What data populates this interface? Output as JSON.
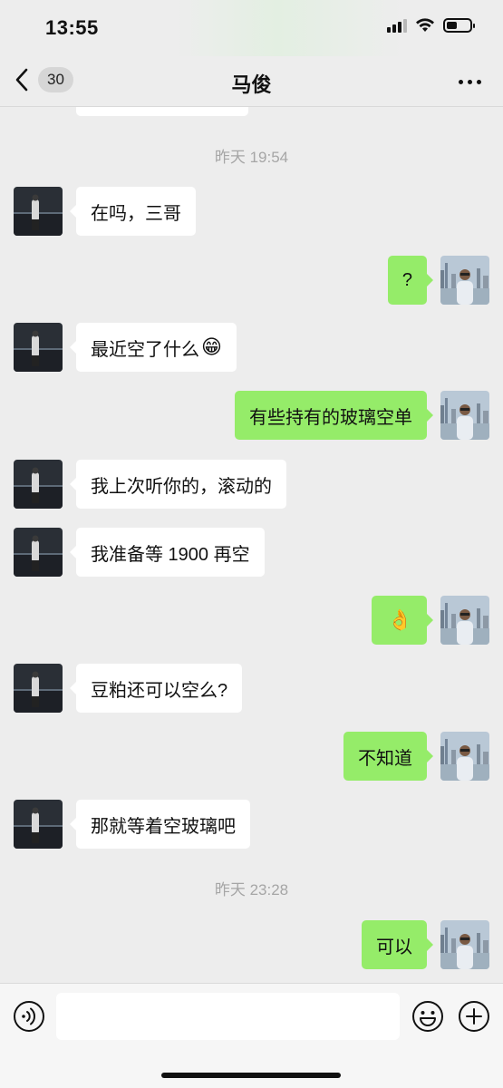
{
  "status_bar": {
    "time": "13:55"
  },
  "nav": {
    "back_badge": "30",
    "title": "马俊"
  },
  "messages": [
    {
      "kind": "time",
      "text": "昨天 19:54"
    },
    {
      "side": "left",
      "text": "在吗，三哥"
    },
    {
      "side": "right",
      "text": "?"
    },
    {
      "side": "left",
      "text": "最近空了什么",
      "emoji": "😁"
    },
    {
      "side": "right",
      "text": "有些持有的玻璃空单"
    },
    {
      "side": "left",
      "text": "我上次听你的，滚动的"
    },
    {
      "side": "left",
      "text": "我准备等 1900 再空"
    },
    {
      "side": "right",
      "text": "",
      "emoji": "👌"
    },
    {
      "side": "left",
      "text": "豆粕还可以空么?"
    },
    {
      "side": "right",
      "text": "不知道"
    },
    {
      "side": "left",
      "text": "那就等着空玻璃吧"
    },
    {
      "kind": "time",
      "text": "昨天 23:28"
    },
    {
      "side": "right",
      "text": "可以"
    }
  ],
  "input": {
    "placeholder": ""
  },
  "colors": {
    "background": "#ededed",
    "sent_bubble": "#95ec69",
    "received_bubble": "#ffffff",
    "timestamp": "#a6a6a6"
  },
  "icons": [
    "back-chevron-icon",
    "more-icon",
    "voice-icon",
    "emoji-icon",
    "plus-icon",
    "signal-icon",
    "wifi-icon",
    "battery-icon"
  ]
}
